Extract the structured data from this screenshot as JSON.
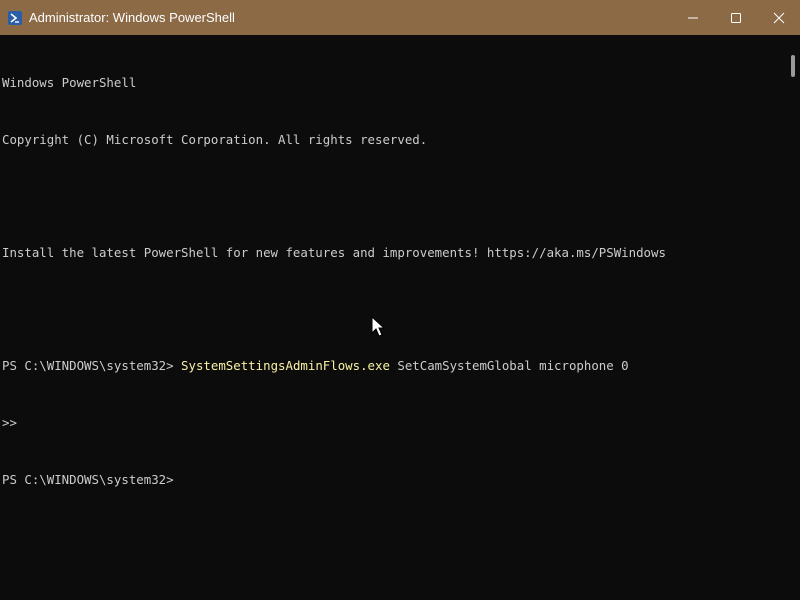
{
  "window": {
    "title": "Administrator: Windows PowerShell",
    "titlebar_color": "#8c6a46",
    "background_color": "#0c0c0c",
    "icons": {
      "app": "powershell-icon",
      "minimize": "minimize-icon",
      "maximize": "maximize-icon",
      "close": "close-icon"
    }
  },
  "console": {
    "header_line_1": "Windows PowerShell",
    "header_line_2": "Copyright (C) Microsoft Corporation. All rights reserved.",
    "install_hint": "Install the latest PowerShell for new features and improvements! https://aka.ms/PSWindows",
    "prompt_1": "PS C:\\WINDOWS\\system32> ",
    "command_exe": "SystemSettingsAdminFlows.exe",
    "command_args": " SetCamSystemGlobal microphone 0",
    "continuation": ">>",
    "prompt_2": "PS C:\\WINDOWS\\system32>",
    "text_color": "#cccccc",
    "command_color": "#f9f1a5"
  }
}
